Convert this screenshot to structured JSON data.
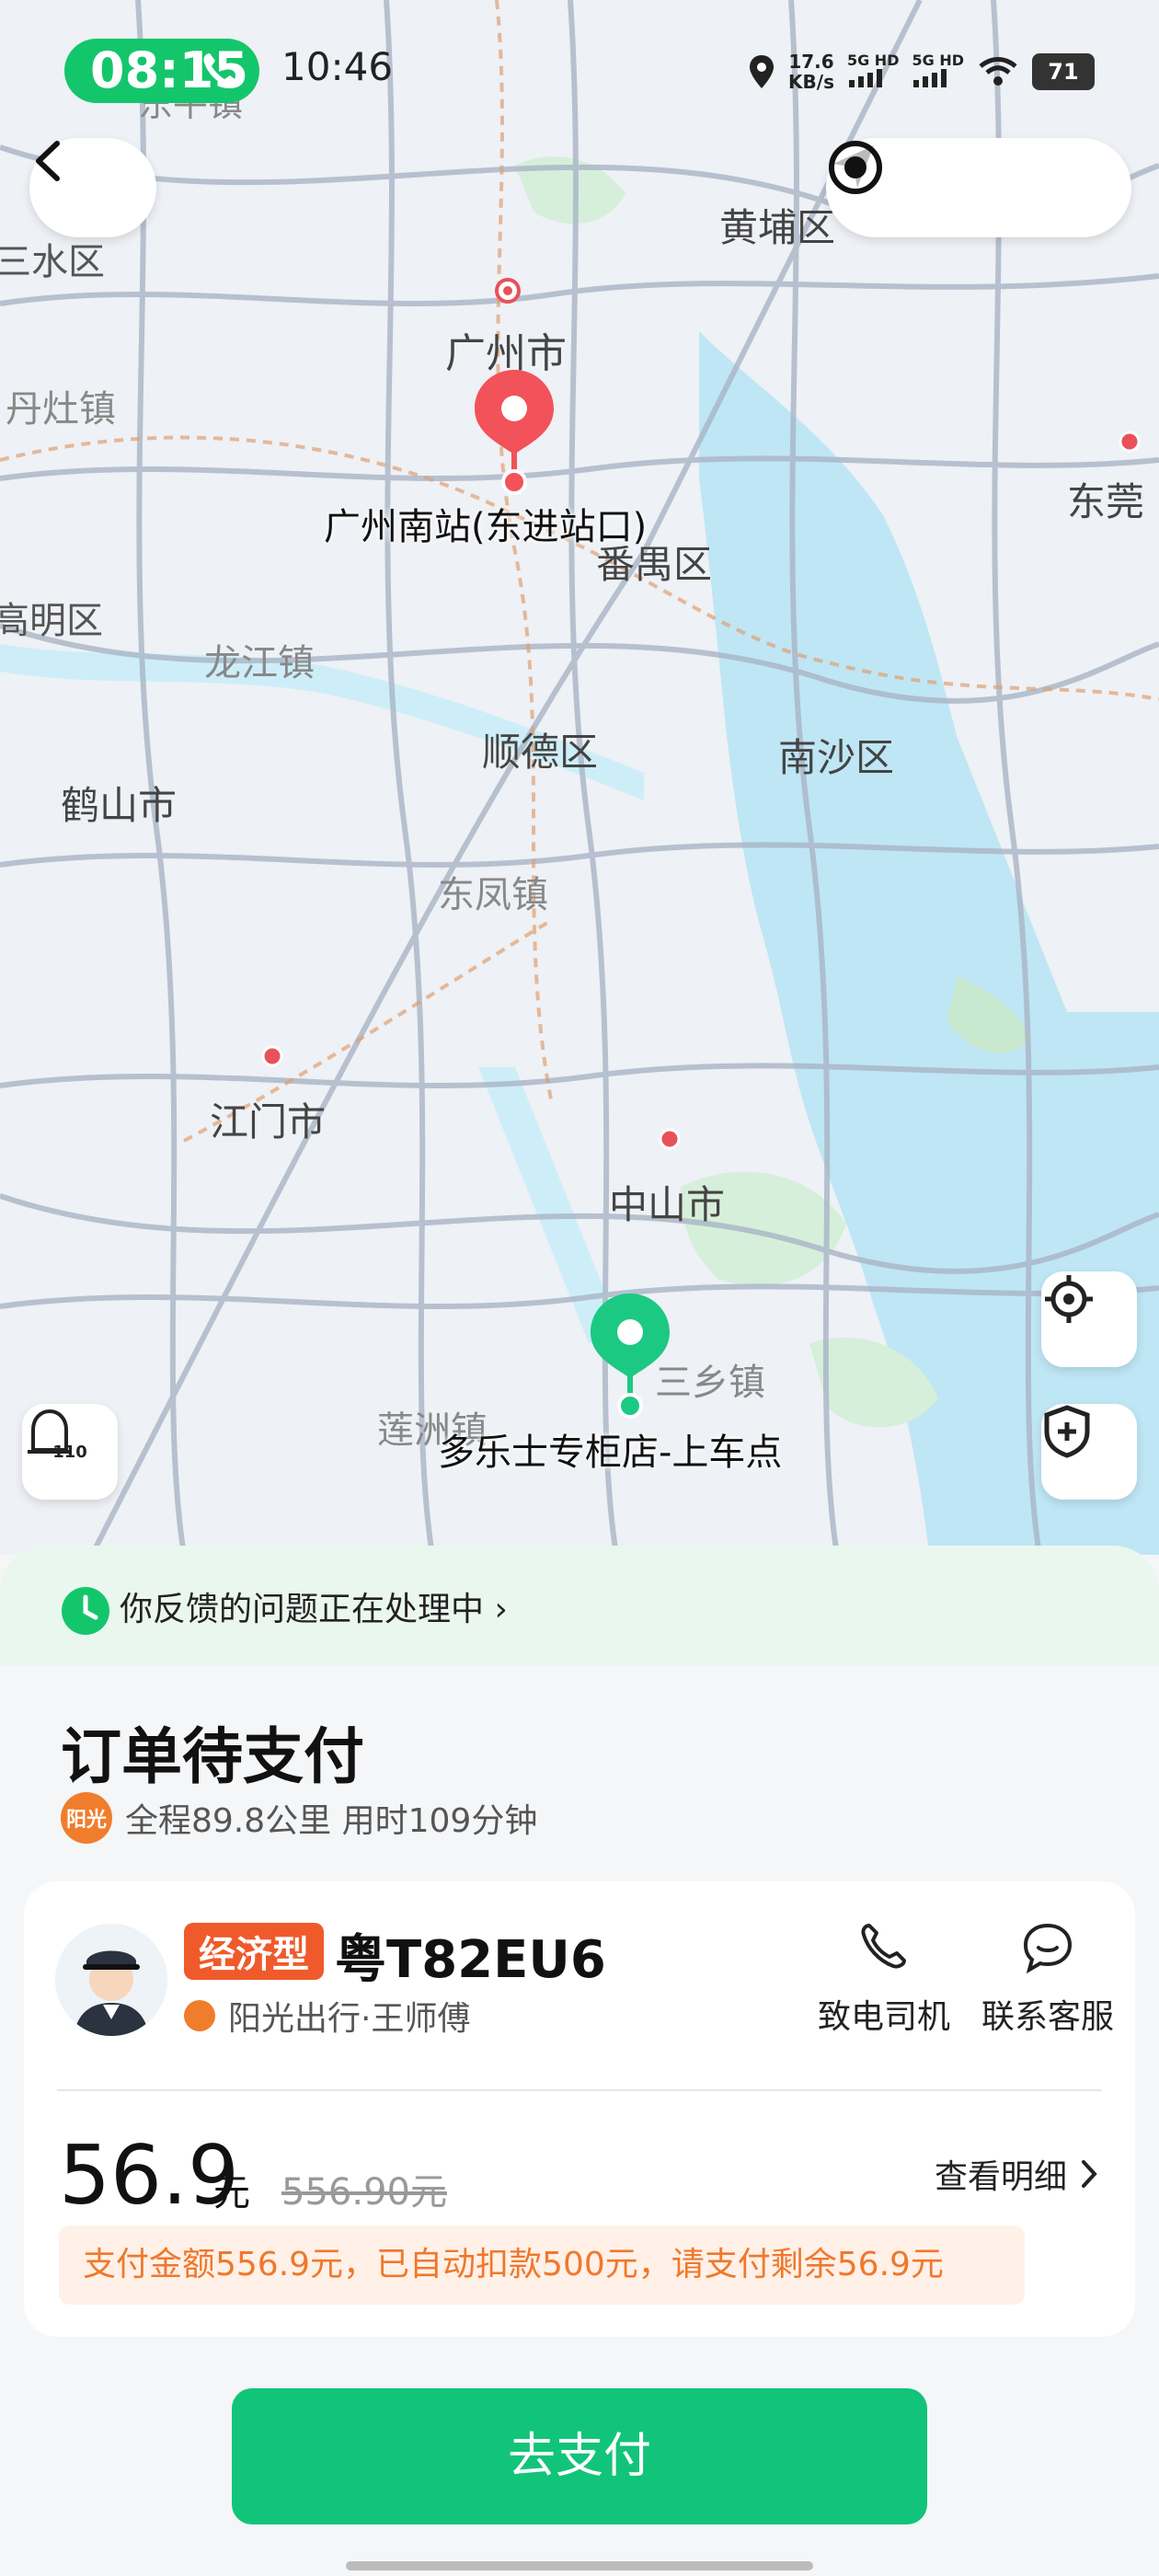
{
  "status_bar": {
    "call_time": "08:15",
    "clock": "10:46",
    "net_speed_value": "17.6",
    "net_speed_unit": "KB/s",
    "sig1": "5G HD",
    "sig2": "5G HD",
    "battery": "71"
  },
  "map": {
    "labels": {
      "huangpu": "黄埔区",
      "guangzhou": "广州市",
      "sanshui": "三水区",
      "danzao": "丹灶镇",
      "dongguan": "东莞",
      "panyu": "番禺区",
      "gaoming": "高明区",
      "longjiang": "龙江镇",
      "shunde": "顺德区",
      "nansha": "南沙区",
      "heshan": "鹤山市",
      "dongfeng": "东凤镇",
      "jiangmen": "江门市",
      "zhongshan": "中山市",
      "sanxiang": "三乡镇",
      "lianzhou": "莲洲镇",
      "top_cut": "东平镇"
    },
    "destination_label": "广州南站(东进站口)",
    "pickup_label": "多乐士专柜店-上车点",
    "police_label": "110"
  },
  "feedback": {
    "text": "你反馈的问题正在处理中 ›"
  },
  "order": {
    "title": "订单待支付",
    "badge": "阳光",
    "trip_info": "全程89.8公里 用时109分钟"
  },
  "driver_card": {
    "type_tag": "经济型",
    "plate": "粤T82EU6",
    "company": "阳光出行·王师傅",
    "call_driver": "致电司机",
    "contact_service": "联系客服"
  },
  "payment": {
    "amount": "56.9",
    "unit": "元",
    "original": "556.90元",
    "detail_link": "查看明细",
    "notice": "支付金额556.9元，已自动扣款500元，请支付剩余56.9元",
    "pay_button": "去支付"
  },
  "colors": {
    "brand_green": "#12c47a",
    "pin_red": "#f2525a",
    "pin_green": "#1cc983",
    "orange": "#f05a2a"
  }
}
